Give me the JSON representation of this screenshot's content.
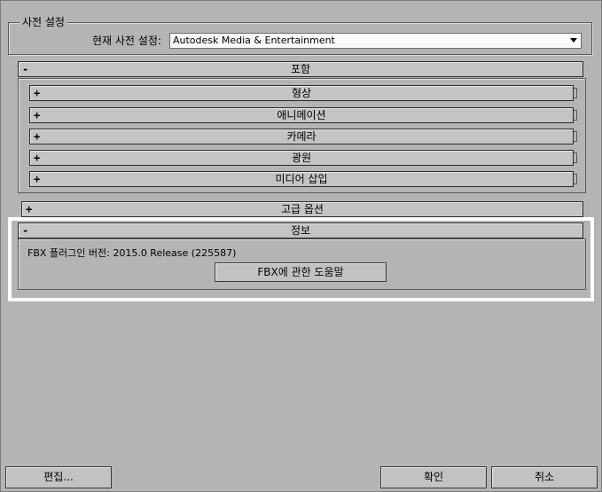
{
  "preset": {
    "group_title": "사전 설정",
    "label": "현재 사전 설정:",
    "value": "Autodesk Media & Entertainment"
  },
  "include": {
    "title": "포함",
    "sign": "-",
    "items": [
      {
        "sign": "+",
        "label": "형상"
      },
      {
        "sign": "+",
        "label": "애니메이션"
      },
      {
        "sign": "+",
        "label": "카메라"
      },
      {
        "sign": "+",
        "label": "광원"
      },
      {
        "sign": "+",
        "label": "미디어 삽입"
      }
    ]
  },
  "advanced": {
    "sign": "+",
    "title": "고급 옵션"
  },
  "info": {
    "sign": "-",
    "title": "정보",
    "version_text": "FBX 플러그인 버전: 2015.0 Release (225587)",
    "help_button": "FBX에 관한 도움말"
  },
  "footer": {
    "edit_button": "편집...",
    "ok_button": "확인",
    "cancel_button": "취소"
  }
}
